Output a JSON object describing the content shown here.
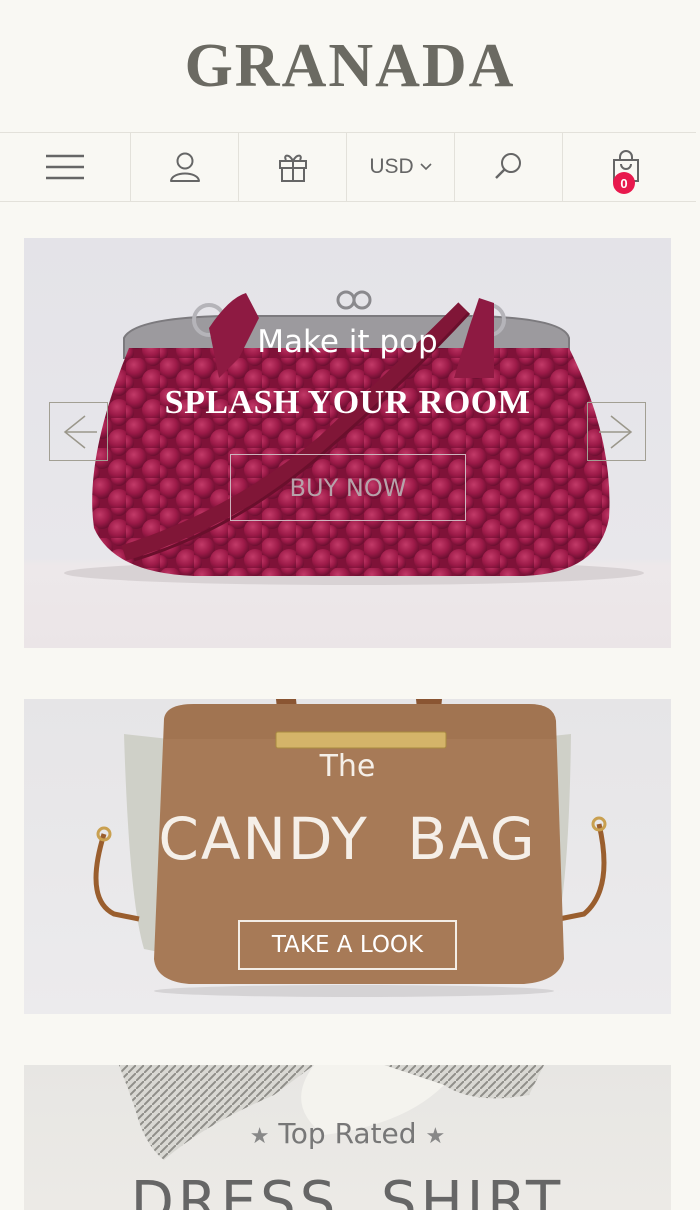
{
  "header": {
    "logo": "GRANADA"
  },
  "toolbar": {
    "menu_icon": "hamburger-icon",
    "account_icon": "user-icon",
    "gift_icon": "gift-icon",
    "currency": "USD",
    "currency_icon": "chevron-down-icon",
    "search_icon": "search-icon",
    "cart_icon": "shopping-bag-icon",
    "cart_count": "0"
  },
  "banners": [
    {
      "subtitle": "Make it pop",
      "title": "SPLASH YOUR ROOM",
      "button": "BUY NOW",
      "prev_icon": "arrow-left-icon",
      "next_icon": "arrow-right-icon"
    },
    {
      "pre_title": "The",
      "title": "CANDY BAG",
      "button": "TAKE A LOOK"
    },
    {
      "subtitle": "Top Rated",
      "title": "DRESS SHIRT"
    }
  ],
  "colors": {
    "background": "#f9f8f3",
    "logo": "#6b6a62",
    "badge": "#e8194d",
    "raspberry": "#9c1a48",
    "leather": "#a77a57"
  }
}
